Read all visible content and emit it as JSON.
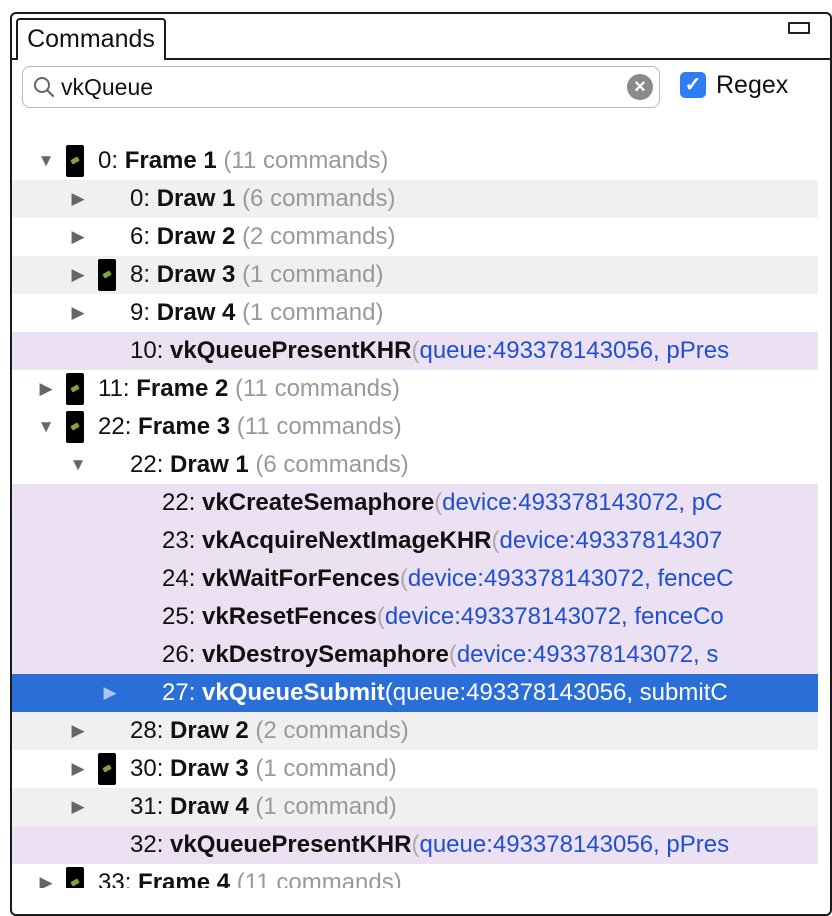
{
  "panel": {
    "tab_label": "Commands"
  },
  "search": {
    "value": "vkQueue",
    "regex_label": "Regex",
    "regex_checked": true
  },
  "tree": [
    {
      "num": "0:",
      "name": "Frame 1",
      "count": "(11 commands)"
    },
    {
      "num": "0:",
      "name": "Draw 1",
      "count": "(6 commands)"
    },
    {
      "num": "6:",
      "name": "Draw 2",
      "count": "(2 commands)"
    },
    {
      "num": "8:",
      "name": "Draw 3",
      "count": "(1 command)"
    },
    {
      "num": "9:",
      "name": "Draw 4",
      "count": "(1 command)"
    },
    {
      "num": "10:",
      "name": "vkQueuePresentKHR",
      "args": "queue:493378143056, pPres"
    },
    {
      "num": "11:",
      "name": "Frame 2",
      "count": "(11 commands)"
    },
    {
      "num": "22:",
      "name": "Frame 3",
      "count": "(11 commands)"
    },
    {
      "num": "22:",
      "name": "Draw 1",
      "count": "(6 commands)"
    },
    {
      "num": "22:",
      "name": "vkCreateSemaphore",
      "args": "device:493378143072, pC"
    },
    {
      "num": "23:",
      "name": "vkAcquireNextImageKHR",
      "args": "device:49337814307"
    },
    {
      "num": "24:",
      "name": "vkWaitForFences",
      "args": "device:493378143072, fenceC"
    },
    {
      "num": "25:",
      "name": "vkResetFences",
      "args": "device:493378143072, fenceCo"
    },
    {
      "num": "26:",
      "name": "vkDestroySemaphore",
      "args": "device:493378143072, s"
    },
    {
      "num": "27:",
      "name": "vkQueueSubmit",
      "args": "queue:493378143056, submitC"
    },
    {
      "num": "28:",
      "name": "Draw 2",
      "count": "(2 commands)"
    },
    {
      "num": "30:",
      "name": "Draw 3",
      "count": "(1 command)"
    },
    {
      "num": "31:",
      "name": "Draw 4",
      "count": "(1 command)"
    },
    {
      "num": "32:",
      "name": "vkQueuePresentKHR",
      "args": "queue:493378143056, pPres"
    },
    {
      "num": "33:",
      "name": "Frame 4",
      "count": "(11 commands)"
    }
  ]
}
